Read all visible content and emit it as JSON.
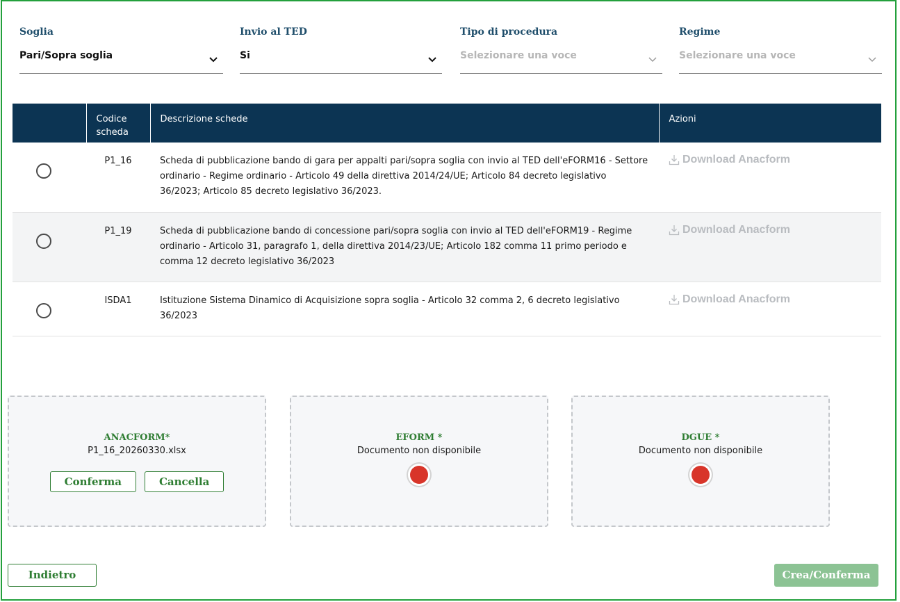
{
  "filters": {
    "soglia": {
      "label": "Soglia",
      "value": "Pari/Sopra soglia"
    },
    "invio_ted": {
      "label": "Invio al TED",
      "value": "Si"
    },
    "tipo_procedura": {
      "label": "Tipo di procedura",
      "placeholder": "Selezionare una voce"
    },
    "regime": {
      "label": "Regime",
      "placeholder": "Selezionare una voce"
    }
  },
  "table": {
    "headers": {
      "select": "",
      "code_line1": "Codice",
      "code_line2": "scheda",
      "description": "Descrizione schede",
      "actions": "Azioni"
    },
    "rows": [
      {
        "code": "P1_16",
        "description": "Scheda di pubblicazione bando di gara per appalti pari/sopra soglia con invio al TED dell'eFORM16 - Settore ordinario - Regime ordinario - Articolo 49 della direttiva 2014/24/UE; Articolo 84 decreto legislativo 36/2023; Articolo 85 decreto legislativo 36/2023.",
        "action": "Download Anacform"
      },
      {
        "code": "P1_19",
        "description": "Scheda di pubblicazione bando di concessione pari/sopra soglia con invio al TED dell'eFORM19 - Regime ordinario - Articolo 31, paragrafo 1, della direttiva 2014/23/UE; Articolo 182 comma 11 primo periodo e comma 12 decreto legislativo 36/2023",
        "action": "Download Anacform"
      },
      {
        "code": "ISDA1",
        "description": "Istituzione Sistema Dinamico di Acquisizione sopra soglia - Articolo 32 comma 2, 6 decreto legislativo 36/2023",
        "action": "Download Anacform"
      }
    ]
  },
  "cards": {
    "anacform": {
      "title": "ANACFORM*",
      "file": "P1_16_20260330.xlsx",
      "confirm": "Conferma",
      "cancel": "Cancella"
    },
    "eform": {
      "title": "EFORM *",
      "status": "Documento non disponibile",
      "status_color": "#d8352a"
    },
    "dgue": {
      "title": "DGUE *",
      "status": "Documento non disponibile",
      "status_color": "#d8352a"
    }
  },
  "footer": {
    "back": "Indietro",
    "submit": "Crea/Conferma"
  },
  "colors": {
    "accent": "#2e7d32",
    "header_bg": "#0c3453",
    "frame": "#23a03c",
    "disabled_primary": "#8cc394"
  }
}
